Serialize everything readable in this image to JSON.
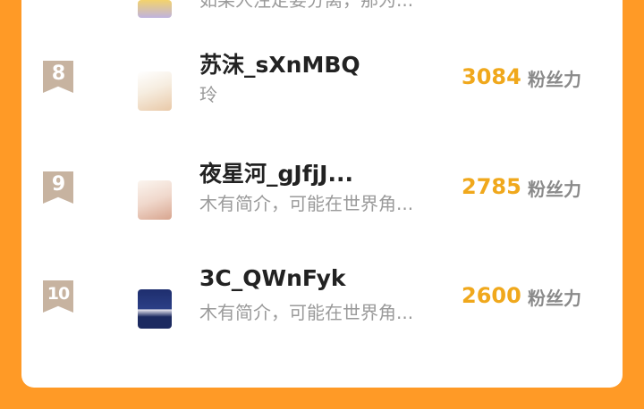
{
  "partial_top": {
    "bio": "如果人注定要分离，那为..."
  },
  "entries": [
    {
      "rank": "8",
      "name": "苏沫_sXnMBQ",
      "bio": "玲",
      "score": "3084",
      "unit": "粉丝力"
    },
    {
      "rank": "9",
      "name": "夜星河_gJfjJ...",
      "bio": "木有简介，可能在世界角...",
      "score": "2785",
      "unit": "粉丝力"
    },
    {
      "rank": "10",
      "name": "3C_QWnFyk",
      "bio": "木有简介，可能在世界角...",
      "score": "2600",
      "unit": "粉丝力"
    }
  ],
  "colors": {
    "background": "#ff9a26",
    "score": "#f0a81c",
    "badge": "#c7b3a0"
  }
}
